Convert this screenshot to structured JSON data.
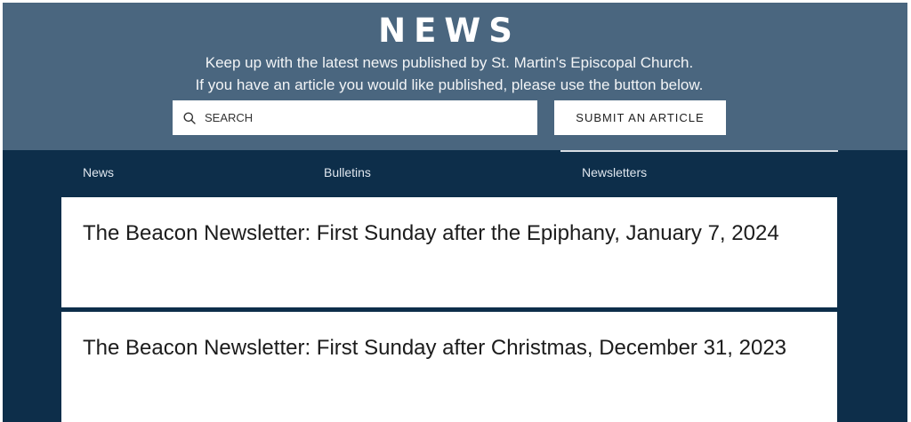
{
  "header": {
    "title": "NEWS",
    "subtitle_line1": "Keep up with the latest news published by St. Martin's Episcopal Church.",
    "subtitle_line2": "If you have an article you would like published, please use the button below."
  },
  "search": {
    "placeholder": "SEARCH",
    "icon": "search-icon"
  },
  "submit_button": {
    "label": "SUBMIT AN ARTICLE"
  },
  "tabs": [
    {
      "label": "News"
    },
    {
      "label": "Bulletins"
    },
    {
      "label": "Newsletters",
      "selected": true
    }
  ],
  "posts": [
    {
      "title": "The Beacon Newsletter: First Sunday after the Epiphany, January 7, 2024"
    },
    {
      "title": "The Beacon Newsletter: First Sunday after Christmas, December 31, 2023"
    }
  ],
  "colors": {
    "hero_bg": "#4a667f",
    "page_bg": "#0d2e4a",
    "card_bg": "#ffffff"
  }
}
